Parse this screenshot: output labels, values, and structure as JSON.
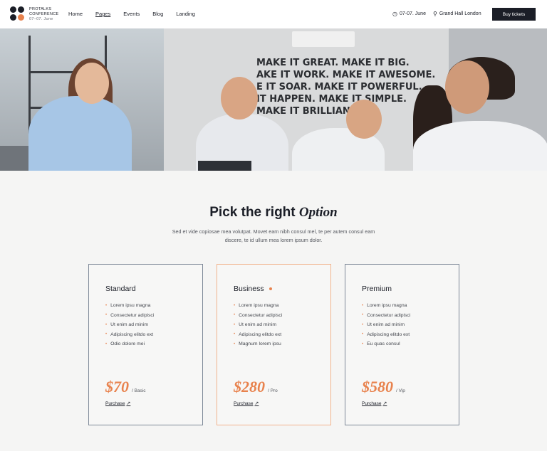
{
  "header": {
    "logo": {
      "line1": "PROTALKS",
      "line2": "CONFERENCE",
      "line3": "07–07. June"
    },
    "nav": [
      "Home",
      "Pages",
      "Events",
      "Blog",
      "Landing"
    ],
    "date_text": "07-07. June",
    "location_text": "Grand Hall London",
    "buy_label": "Buy tickets"
  },
  "hero": {
    "slogan": "MAKE IT GREAT. MAKE IT BIG.\nAKE IT WORK. MAKE IT AWESOME.\nE IT SOAR. MAKE IT POWERFUL.\nIT HAPPEN. MAKE IT SIMPLE.\nMAKE IT BRILLIANT."
  },
  "section": {
    "title_plain": "Pick the right",
    "title_italic": "Option",
    "description": "Sed et vide copiosae mea volutpat. Movet eam nibh consul mel, te per autem consul eam discere, te id ullum mea lorem ipsum dolor."
  },
  "plans": [
    {
      "name": "Standard",
      "features": [
        "Lorem ipsu magna",
        "Consectetur adipisci",
        "Ut enim ad minim",
        "Adipiscing elitdo ext",
        "Odio dolore mei"
      ],
      "price": "$70",
      "period": "/ Basic",
      "purchase_label": "Purchase",
      "featured": false
    },
    {
      "name": "Business",
      "features": [
        "Lorem ipsu magna",
        "Consectetur adipisci",
        "Ut enim ad minim",
        "Adipiscing elitdo ext",
        "Magnum lorem ipsu"
      ],
      "price": "$280",
      "period": "/ Pro",
      "purchase_label": "Purchase",
      "featured": true
    },
    {
      "name": "Premium",
      "features": [
        "Lorem ipsu magna",
        "Consectetur adipisci",
        "Ut enim ad minim",
        "Adipiscing elitdo ext",
        "Eu quas consul"
      ],
      "price": "$580",
      "period": "/ Vip",
      "purchase_label": "Purchase",
      "featured": false
    }
  ],
  "colors": {
    "accent": "#e8824d",
    "dark": "#1b1e27",
    "card_border": "#7f8a99",
    "featured_border": "#f1b48e"
  },
  "icons": {
    "date": "clock-icon",
    "location": "map-pin-icon",
    "purchase": "arrow-up-right-icon",
    "feature_bullet": "bullet-icon"
  }
}
